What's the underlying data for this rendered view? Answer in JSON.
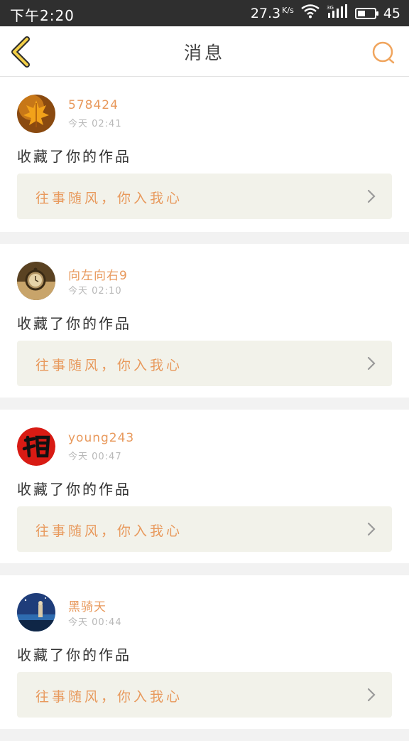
{
  "status_bar": {
    "time": "下午2:20",
    "net_speed": "27.3",
    "net_unit": "K/s",
    "battery": "45",
    "battery_level": 0.45
  },
  "header": {
    "title": "消息",
    "back_icon": "chevron-left-icon",
    "search_icon": "search-icon"
  },
  "accent_color": "#e8995c",
  "messages": [
    {
      "username": "578424",
      "time": "今天 02:41",
      "action": "收藏了你的作品",
      "work_title": "往事随风，你入我心",
      "avatar": "maple-leaf"
    },
    {
      "username": "向左向右9",
      "time": "今天 02:10",
      "action": "收藏了你的作品",
      "work_title": "往事随风，你入我心",
      "avatar": "pocket-watch"
    },
    {
      "username": "young243",
      "time": "今天 00:47",
      "action": "收藏了你的作品",
      "work_title": "往事随风，你入我心",
      "avatar": "red-calligraphy"
    },
    {
      "username": "黑骑天",
      "time": "今天 00:44",
      "action": "收藏了你的作品",
      "work_title": "往事随风，你入我心",
      "avatar": "night-scene"
    }
  ]
}
